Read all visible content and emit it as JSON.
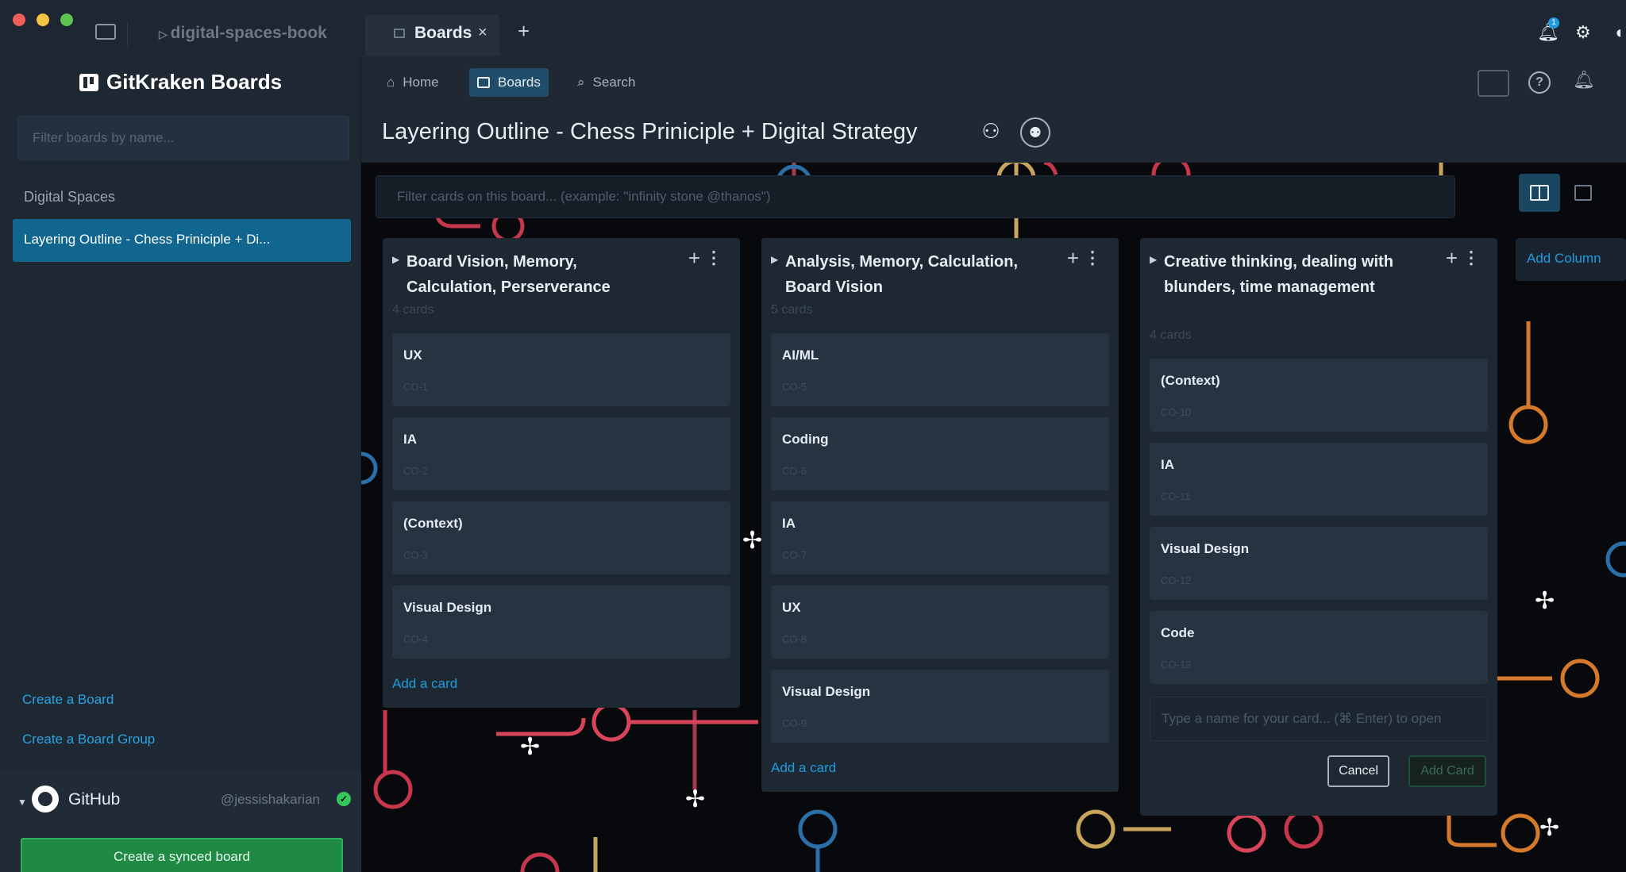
{
  "titlebar": {
    "repo_name": "digital-spaces-book",
    "tab_label": "Boards",
    "tab_close": "×",
    "tab_add": "+",
    "notification_badge": "1",
    "colors": {
      "red": "#ee5f57",
      "yellow": "#f5c443",
      "green": "#5ec452"
    }
  },
  "sidebar": {
    "app_name": "GitKraken Boards",
    "filter_placeholder": "Filter boards by name...",
    "group_label": "Digital Spaces",
    "active_board": "Layering Outline - Chess Priniciple + Di...",
    "create_board": "Create a Board",
    "create_board_group": "Create a Board Group",
    "github_label": "GitHub",
    "github_user": "@jessishakarian",
    "create_synced_board": "Create a synced board"
  },
  "nav": {
    "home": "Home",
    "boards": "Boards",
    "search": "Search"
  },
  "board": {
    "title": "Layering Outline - Chess Priniciple + Digital Strategy",
    "filter_placeholder": "Filter cards on this board... (example: \"infinity stone @thanos\")",
    "add_column": "Add Column",
    "add_card_link": "Add a card",
    "accent_color": "#1f9bde"
  },
  "columns": [
    {
      "title": "Board Vision, Memory, Calculation, Perserverance",
      "count": "4 cards",
      "cards": [
        {
          "title": "UX",
          "id": "CO-1"
        },
        {
          "title": "IA",
          "id": "CO-2"
        },
        {
          "title": "(Context)",
          "id": "CO-3"
        },
        {
          "title": "Visual Design",
          "id": "CO-4"
        }
      ]
    },
    {
      "title": "Analysis, Memory, Calculation, Board Vision",
      "count": "5 cards",
      "cards": [
        {
          "title": "AI/ML",
          "id": "CO-5"
        },
        {
          "title": "Coding",
          "id": "CO-6"
        },
        {
          "title": "IA",
          "id": "CO-7"
        },
        {
          "title": "UX",
          "id": "CO-8"
        },
        {
          "title": "Visual Design",
          "id": "CO-9"
        }
      ]
    },
    {
      "title": "Creative thinking, dealing with blunders, time management",
      "count": "4 cards",
      "cards": [
        {
          "title": "(Context)",
          "id": "CO-10"
        },
        {
          "title": "IA",
          "id": "CO-11"
        },
        {
          "title": "Visual Design",
          "id": "CO-12"
        },
        {
          "title": "Code",
          "id": "CO-13"
        }
      ],
      "new_card_placeholder": "Type a name for your card... (⌘ Enter) to open",
      "cancel_label": "Cancel",
      "add_card_label": "Add Card"
    }
  ]
}
